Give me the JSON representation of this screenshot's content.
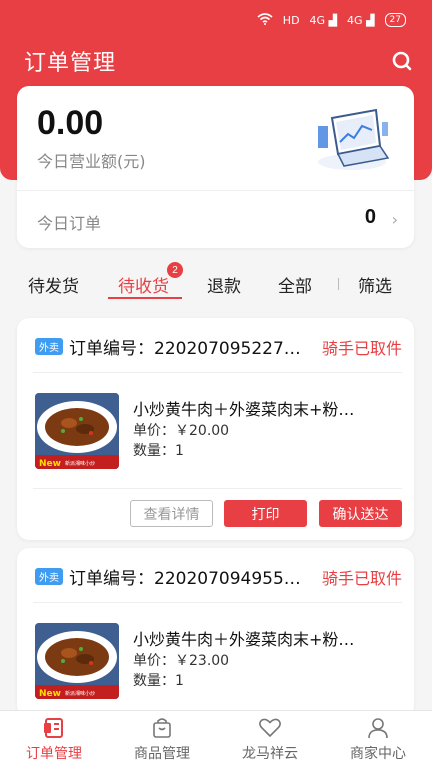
{
  "status_bar": {
    "network": "HD",
    "signal1": "4G",
    "signal2": "4G",
    "battery": "27"
  },
  "header": {
    "title": "订单管理"
  },
  "summary": {
    "amount": "0.00",
    "amount_label": "今日营业额(元)",
    "today_orders_label": "今日订单",
    "today_orders_count": "0"
  },
  "tabs": [
    {
      "label": "待发货"
    },
    {
      "label": "待收货",
      "badge": "2"
    },
    {
      "label": "退款"
    },
    {
      "label": "全部"
    },
    {
      "label": "筛选"
    }
  ],
  "orders": [
    {
      "tag": "外卖",
      "order_no": "订单编号：220207095227…",
      "status": "骑手已取件",
      "item_name": "小炒黄牛肉＋外婆菜肉末+粉…",
      "price": "单价：￥20.00",
      "qty": "数量：1",
      "btn_details": "查看详情",
      "btn_print": "打印",
      "btn_confirm": "确认送达"
    },
    {
      "tag": "外卖",
      "order_no": "订单编号：220207094955…",
      "status": "骑手已取件",
      "item_name": "小炒黄牛肉＋外婆菜肉末+粉…",
      "price": "单价：￥23.00",
      "qty": "数量：1"
    }
  ],
  "bottom_nav": [
    {
      "label": "订单管理",
      "icon": "order-icon"
    },
    {
      "label": "商品管理",
      "icon": "bag-icon"
    },
    {
      "label": "龙马祥云",
      "icon": "heart-icon"
    },
    {
      "label": "商家中心",
      "icon": "user-icon"
    }
  ],
  "colors": {
    "accent": "#e83f44",
    "tag_blue": "#3f9cf0"
  }
}
